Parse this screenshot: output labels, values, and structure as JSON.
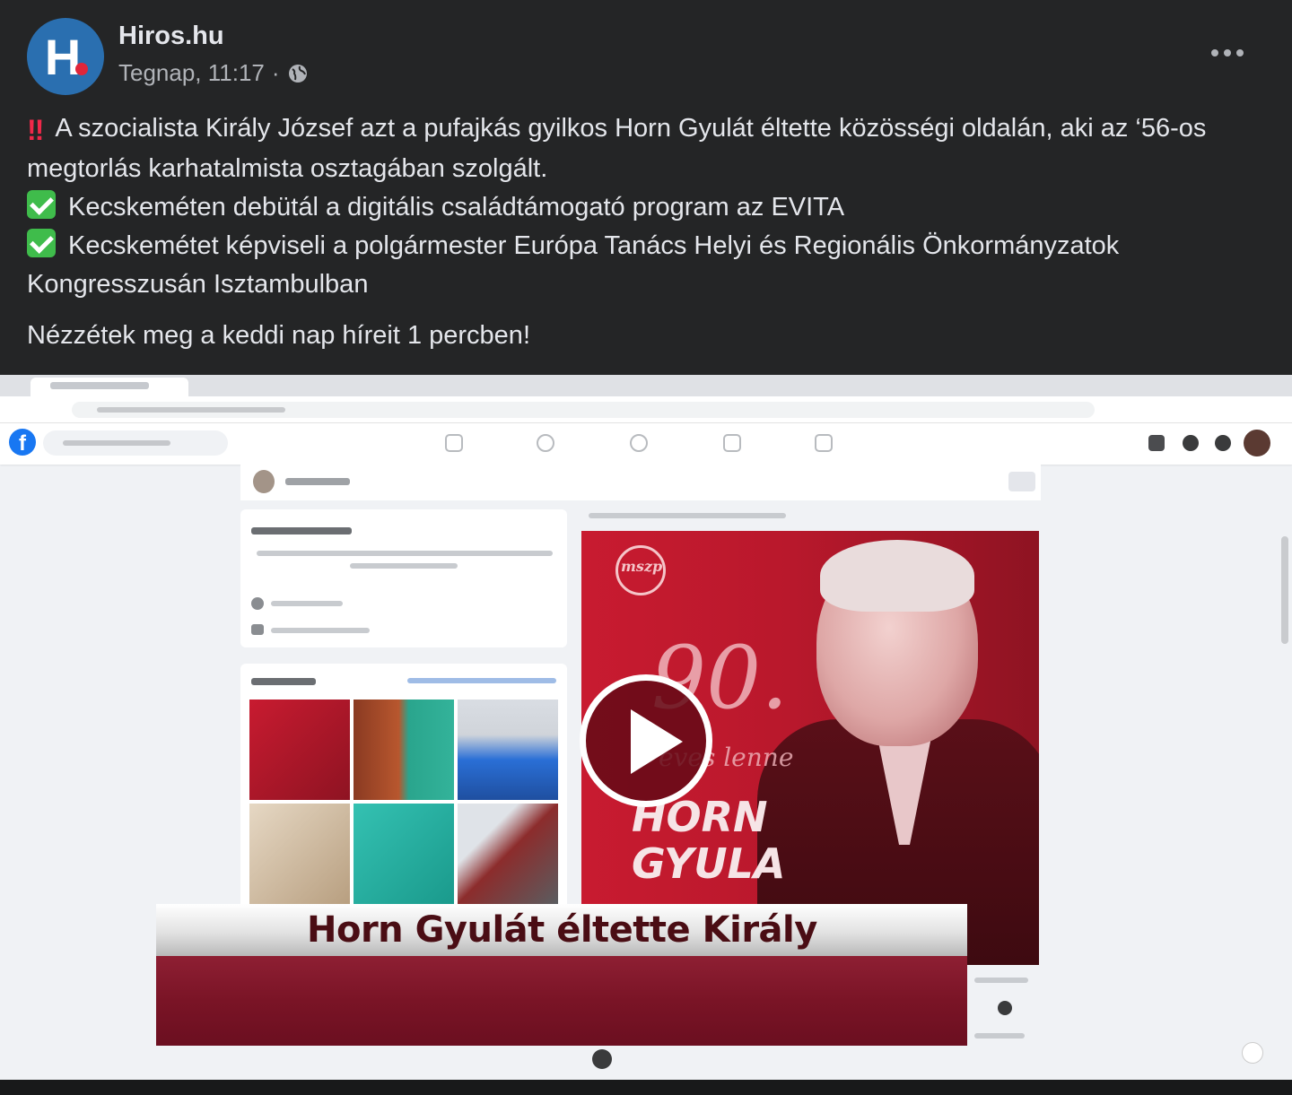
{
  "post": {
    "page_name": "Hiros.hu",
    "avatar_letter": "H",
    "timestamp": "Tegnap, 11:17",
    "separator": "·",
    "audience_icon": "globe-icon",
    "more_icon": "more-horizontal-icon",
    "lines": [
      "A szocialista Király József azt a pufajkás gyilkos Horn Gyulát éltette közösségi oldalán, aki az ‘56-os megtorlás karhatalmista osztagában szolgált.",
      "Kecskeméten debütál a digitális családtámogató program az EVITA",
      "Kecskemétet képviseli a polgármester Európa Tanács Helyi és Regionális Önkormányzatok Kongresszusán Isztambulban",
      "Nézzétek meg a keddi nap híreit 1 percben!"
    ],
    "line_icons": [
      "double-exclamation-icon",
      "check-mark-button-icon",
      "check-mark-button-icon"
    ],
    "bang_glyph": "‼"
  },
  "video": {
    "poster_number": "90.",
    "poster_sub": "éves lenne",
    "poster_name_line1": "HORN",
    "poster_name_line2": "GYULA",
    "poster_logo_text": "mszp",
    "caption": "Horn Gyulát éltette Király",
    "play_icon": "play-icon"
  },
  "colors": {
    "background": "#242526",
    "text": "#e4e6eb",
    "secondary_text": "#b0b3b8",
    "avatar": "#2a6fb0",
    "check_green": "#3fbc4b",
    "bang_red": "#f02849",
    "poster_red": "#c81b30"
  }
}
